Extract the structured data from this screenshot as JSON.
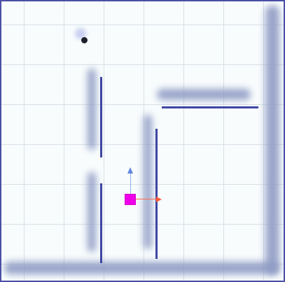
{
  "scene": {
    "colors": {
      "background": "#f8fcfd",
      "grid": "#d8e0e6",
      "wall": "#3f46a3",
      "wall_shadow": "#8f9bc4",
      "gizmo_cube": "#f000e8",
      "x_axis": "#ff5a3a",
      "y_axis": "#5f86df",
      "agent": "#1e1e2a"
    },
    "objects": [
      "boundary-wall-right",
      "boundary-wall-bottom",
      "wall-upper-left",
      "wall-lower-left",
      "wall-middle",
      "wall-horizontal-top",
      "agent-dot",
      "transform-gizmo"
    ],
    "icons": {
      "cube": "selected-object-cube-icon",
      "x_arrow": "x-axis-arrow-icon",
      "y_arrow": "y-axis-arrow-icon"
    }
  }
}
